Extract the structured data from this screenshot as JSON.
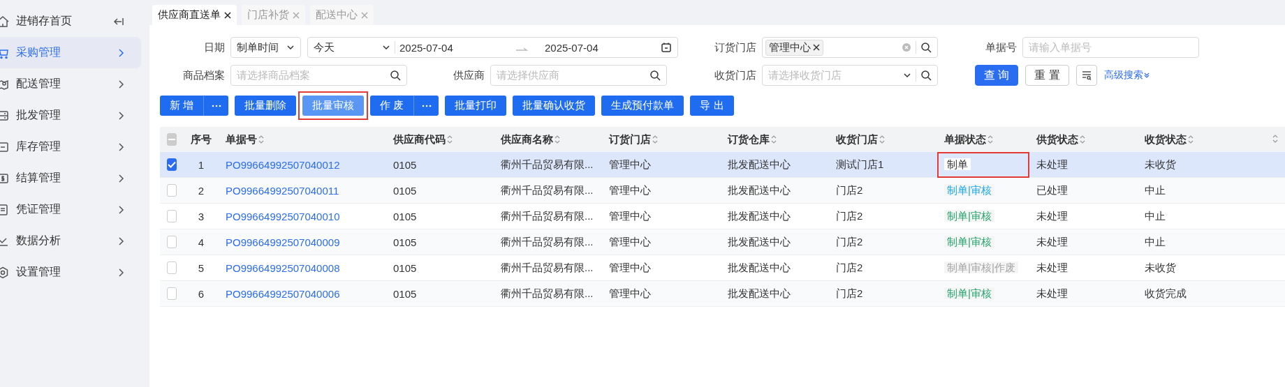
{
  "sidebar": {
    "items": [
      {
        "label": "进销存首页",
        "kind": "home",
        "selected": false
      },
      {
        "label": "采购管理",
        "kind": "menu",
        "selected": true
      },
      {
        "label": "配送管理",
        "kind": "menu",
        "selected": false
      },
      {
        "label": "批发管理",
        "kind": "menu",
        "selected": false
      },
      {
        "label": "库存管理",
        "kind": "menu",
        "selected": false
      },
      {
        "label": "结算管理",
        "kind": "menu",
        "selected": false
      },
      {
        "label": "凭证管理",
        "kind": "menu",
        "selected": false
      },
      {
        "label": "数据分析",
        "kind": "menu",
        "selected": false
      },
      {
        "label": "设置管理",
        "kind": "menu",
        "selected": false
      }
    ]
  },
  "tabs": [
    {
      "label": "供应商直送单",
      "selected": true
    },
    {
      "label": "门店补货",
      "selected": false
    },
    {
      "label": "配送中心",
      "selected": false
    }
  ],
  "filters": {
    "date": {
      "label": "日期",
      "type_value": "制单时间",
      "preset": "今天",
      "start": "2025-07-04",
      "end": "2025-07-04"
    },
    "order_store": {
      "label": "订货门店",
      "tags": [
        "管理中心"
      ]
    },
    "doc_no": {
      "label": "单据号",
      "placeholder": "请输入单据号"
    },
    "product": {
      "label": "商品档案",
      "placeholder": "请选择商品档案"
    },
    "supplier": {
      "label": "供应商",
      "placeholder": "请选择供应商"
    },
    "receive_store": {
      "label": "收货门店",
      "placeholder": "请选择收货门店"
    },
    "query": "查 询",
    "reset": "重 置",
    "advanced": "高级搜索"
  },
  "toolbar": [
    {
      "label": "新 增",
      "kind": "split",
      "hovered": false,
      "highlighted": false
    },
    {
      "label": "批量删除",
      "kind": "plain",
      "hovered": false,
      "highlighted": false
    },
    {
      "label": "批量审核",
      "kind": "plain",
      "hovered": true,
      "highlighted": true
    },
    {
      "label": "作 废",
      "kind": "split",
      "hovered": false,
      "highlighted": false
    },
    {
      "label": "批量打印",
      "kind": "plain",
      "hovered": false,
      "highlighted": false
    },
    {
      "label": "批量确认收货",
      "kind": "plain",
      "hovered": false,
      "highlighted": false
    },
    {
      "label": "生成预付款单",
      "kind": "plain",
      "hovered": false,
      "highlighted": false
    },
    {
      "label": "导 出",
      "kind": "plain",
      "hovered": false,
      "highlighted": false
    }
  ],
  "table": {
    "select_all": {
      "indeterminate": true
    },
    "columns": [
      {
        "label": "序号",
        "sortable": false
      },
      {
        "label": "单据号",
        "sortable": true
      },
      {
        "label": "供应商代码",
        "sortable": true
      },
      {
        "label": "供应商名称",
        "sortable": true
      },
      {
        "label": "订货门店",
        "sortable": true
      },
      {
        "label": "订货仓库",
        "sortable": true
      },
      {
        "label": "收货门店",
        "sortable": true
      },
      {
        "label": "单据状态",
        "sortable": true
      },
      {
        "label": "供货状态",
        "sortable": true
      },
      {
        "label": "收货状态",
        "sortable": true
      },
      {
        "sortable": true
      }
    ],
    "rows": [
      {
        "selected": true,
        "seq": "1",
        "doc_no": "PO99664992507040012",
        "supplier_code": "0105",
        "supplier_name": "衢州千品贸易有限...",
        "order_store": "管理中心",
        "order_warehouse": "批发配送中心",
        "receive_store": "测试门店1",
        "doc_status": {
          "text": "制单",
          "color": "#333333",
          "highlighted": true
        },
        "supply_status": "未处理",
        "receive_status": "未收货"
      },
      {
        "selected": false,
        "seq": "2",
        "doc_no": "PO99664992507040011",
        "supplier_code": "0105",
        "supplier_name": "衢州千品贸易有限...",
        "order_store": "管理中心",
        "order_warehouse": "批发配送中心",
        "receive_store": "门店2",
        "doc_status": {
          "text": "制单|审核",
          "color": "#1ba8e8",
          "highlighted": false
        },
        "supply_status": "已处理",
        "receive_status": "中止"
      },
      {
        "selected": false,
        "seq": "3",
        "doc_no": "PO99664992507040010",
        "supplier_code": "0105",
        "supplier_name": "衢州千品贸易有限...",
        "order_store": "管理中心",
        "order_warehouse": "批发配送中心",
        "receive_store": "门店2",
        "doc_status": {
          "text": "制单|审核",
          "color": "#24a46d",
          "highlighted": false
        },
        "supply_status": "未处理",
        "receive_status": "中止"
      },
      {
        "selected": false,
        "seq": "4",
        "doc_no": "PO99664992507040009",
        "supplier_code": "0105",
        "supplier_name": "衢州千品贸易有限...",
        "order_store": "管理中心",
        "order_warehouse": "批发配送中心",
        "receive_store": "门店2",
        "doc_status": {
          "text": "制单|审核",
          "color": "#24a46d",
          "highlighted": false
        },
        "supply_status": "未处理",
        "receive_status": "中止"
      },
      {
        "selected": false,
        "seq": "5",
        "doc_no": "PO99664992507040008",
        "supplier_code": "0105",
        "supplier_name": "衢州千品贸易有限...",
        "order_store": "管理中心",
        "order_warehouse": "批发配送中心",
        "receive_store": "门店2",
        "doc_status": {
          "text": "制单|审核|作废",
          "color": "#a6a6a6",
          "highlighted": false
        },
        "supply_status": "未处理",
        "receive_status": "未收货"
      },
      {
        "selected": false,
        "seq": "6",
        "doc_no": "PO99664992507040006",
        "supplier_code": "0105",
        "supplier_name": "衢州千品贸易有限...",
        "order_store": "管理中心",
        "order_warehouse": "批发配送中心",
        "receive_store": "门店2",
        "doc_status": {
          "text": "制单|审核",
          "color": "#24a46d",
          "highlighted": false
        },
        "supply_status": "未处理",
        "receive_status": "收货完成"
      }
    ]
  }
}
